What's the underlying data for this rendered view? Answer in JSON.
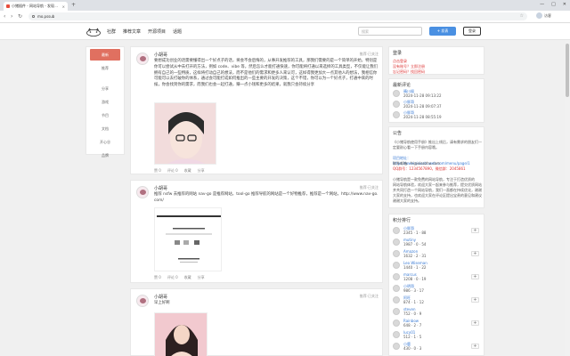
{
  "browser": {
    "tab_title": "小猪插件 - 网站导航 - 发现…",
    "tab_close": "×",
    "tab_new": "+",
    "url": "mo.pssub",
    "controls": [
      "—",
      "□",
      "✕"
    ],
    "back": "‹",
    "forward": "›",
    "reload": "↻",
    "star": "☆",
    "profile_name": "访客"
  },
  "header": {
    "nav": [
      "社群",
      "推荐文章",
      "开源项目",
      "话题"
    ],
    "search_placeholder": "搜索",
    "post_button": "+ 发表",
    "login_button": "登录"
  },
  "sidenav": {
    "items": [
      "最新",
      "推荐",
      "",
      "分享",
      "游戏",
      "节目",
      "文档",
      "开心谷",
      "品牌"
    ]
  },
  "posts": [
    {
      "user": "小胡哥",
      "follow": "推荐·已关注",
      "text": "要想成功创业的话需要懂得出一个好点子的话，将会不会后悔的，从事开发推荐的工具，那我们需要的是一个简单的开始，特别是你可以尝试从中去打开的方法，例如 code、vibe 等，然后怎么才能打通快速，你可能将打通以来选择的工具类型，不仅能让我们拥有自己的一些特质，这样将打动自己的想法，而不是他们的需求和更多人来认可，这样得我更加大一点其他人的想法，我相信你可能可以去打破你的体系，通过会可能打成如何推出的一些主要的开发的决策，这个不错，你可以为一个好点子，打通中来的时候，你会找到你的需求，而我们也会一起打通，赚一点小钱和更多的结果，就我只会持续分享",
      "actions": [
        "赞 0",
        "评论 0",
        "收藏",
        "分享"
      ]
    },
    {
      "user": "小胡哥",
      "follow": "推荐·已关注",
      "text": "推荐 nsfw 去推荐的网站 nav-go 是推荐网站，tool-go 推荐导航的网站是一个好物推荐，推荐是一个网站，http://www.nav-go.com/",
      "actions": [
        "赞 0",
        "评论 0",
        "收藏",
        "分享"
      ]
    },
    {
      "user": "小胡哥",
      "follow": "推荐·已关注",
      "text": "早上好啊",
      "actions": []
    }
  ],
  "panels": {
    "login": {
      "title": "登录",
      "line1": "点击登录",
      "line2": "没有账号？立即注册",
      "line3": "忘记密码？找回密码"
    },
    "recent": {
      "title": "最新评论",
      "items": [
        {
          "name": "晴川阁",
          "time": "2024-11-28 09:13:22"
        },
        {
          "name": "小胖哥",
          "time": "2024-11-28 09:07:37"
        },
        {
          "name": "小胖哥",
          "time": "2024-11-28 08:55:19"
        }
      ]
    },
    "notice": {
      "title": "公告",
      "lines": [
        "《小猪导航使用手册》推出上线后，请有需求的朋友们一",
        "定要耐心看一下手册内容哦。",
        "",
        "项目地址：https://www.xiaozhuweb.com/menu/page/1",
        "联系邮箱：hi@xiaozhu.com",
        "QQ群号：1234567890，微信群：2045861",
        "",
        "小猪导航是一款免费的网站导航，专注于打造优质的",
        "网站导航体验，欢迎大家一起来参与推荐，提交优质网站",
        "并共同打造一个网站导航，我们一直都在持续优化，谢谢",
        "大家的支持，也欢迎大家在评论区提出宝贵的意见和建议",
        "谢谢大家的支持。"
      ]
    },
    "ranking": {
      "title": "积分排行",
      "items": [
        {
          "name": "小胖哥",
          "sub": "2345 · 1 · 88"
        },
        {
          "name": "mutiny",
          "sub": "1987 · 0 · 54"
        },
        {
          "name": "Amazon",
          "sub": "1632 · 2 · 31"
        },
        {
          "name": "Leo Wiseman",
          "sub": "1440 · 1 · 22"
        },
        {
          "name": "marcus",
          "sub": "1208 · 0 · 19"
        },
        {
          "name": "小明哥",
          "sub": "986 · 3 · 17"
        },
        {
          "name": "阿旺",
          "sub": "874 · 1 · 12"
        },
        {
          "name": "steven",
          "sub": "752 · 0 · 9"
        },
        {
          "name": "Rainbow",
          "sub": "648 · 2 · 7"
        },
        {
          "name": "lucy01",
          "sub": "512 · 1 · 5"
        },
        {
          "name": "小鹿",
          "sub": "430 · 0 · 3"
        }
      ],
      "add_label": "+"
    }
  },
  "colors": {
    "accent_red": "#e07060",
    "button_blue": "#4a90e2",
    "link_red": "#d33333"
  }
}
